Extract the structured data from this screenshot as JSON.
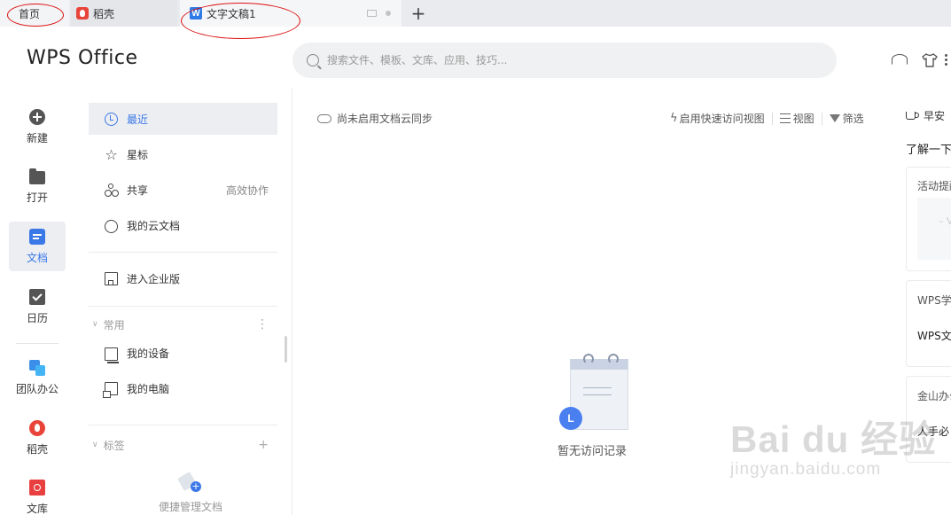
{
  "tabs": [
    {
      "label": "首页"
    },
    {
      "label": "稻壳",
      "icon": "daoke-icon"
    },
    {
      "label": "文字文稿1",
      "icon": "writer-icon"
    }
  ],
  "header": {
    "logo": "WPS Office",
    "search_placeholder": "搜索文件、模板、文库、应用、技巧..."
  },
  "leftnav": [
    {
      "label": "新建",
      "icon": "plus-circle-icon"
    },
    {
      "label": "打开",
      "icon": "folder-icon"
    },
    {
      "label": "文档",
      "icon": "document-icon"
    },
    {
      "label": "日历",
      "icon": "calendar-icon"
    },
    {
      "label": "团队办公",
      "icon": "team-icon"
    },
    {
      "label": "稻壳",
      "icon": "daoke-icon"
    },
    {
      "label": "文库",
      "icon": "library-icon"
    }
  ],
  "sidebar": {
    "items": [
      {
        "label": "最近"
      },
      {
        "label": "星标"
      },
      {
        "label": "共享",
        "extra": "高效协作"
      },
      {
        "label": "我的云文档"
      },
      {
        "label": "进入企业版"
      }
    ],
    "common_header": "常用",
    "common_items": [
      {
        "label": "我的设备"
      },
      {
        "label": "我的电脑"
      }
    ],
    "tags_header": "标签",
    "tags_empty": "便捷管理文档"
  },
  "main": {
    "cloud_sync": "尚未启用文档云同步",
    "quick_access": "启用快速访问视图",
    "view": "视图",
    "filter": "筛选",
    "empty_text": "暂无访问记录",
    "empty_badge": "L"
  },
  "right_panel": {
    "greeting": "早安",
    "title": "了解一下",
    "cards": [
      {
        "title": "活动提醒",
        "dash": "– V"
      },
      {
        "title": "WPS学",
        "body": "WPS文"
      },
      {
        "title": "金山办公",
        "body": "人手必"
      }
    ]
  },
  "watermark": {
    "main": "Bai du 经验",
    "sub": "jingyan.baidu.com"
  },
  "colors": {
    "accent": "#3b78e7",
    "annotation_ring": "#dd1111"
  }
}
